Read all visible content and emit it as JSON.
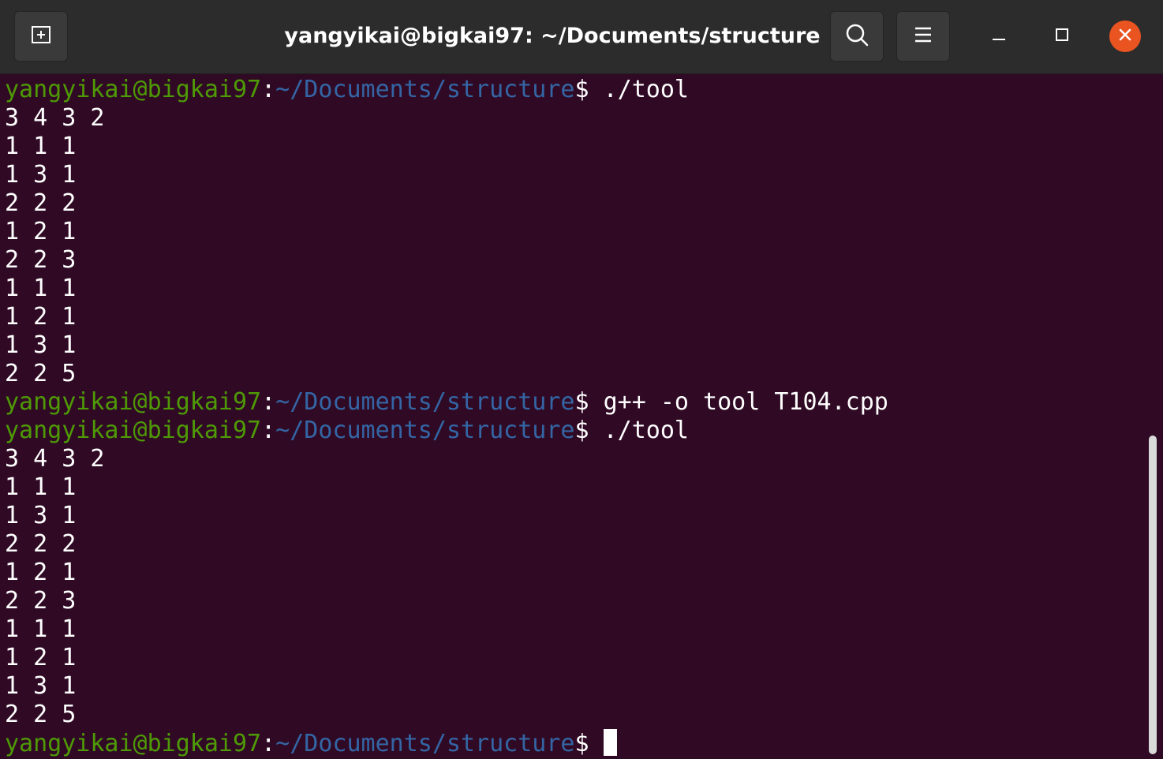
{
  "window": {
    "title": "yangyikai@bigkai97: ~/Documents/structure",
    "accent_close": "#e95420",
    "background": "#300a24"
  },
  "headerbar": {
    "new_tab_icon": "new-tab-icon",
    "search_icon": "search-icon",
    "menu_icon": "hamburger-menu-icon",
    "minimize_icon": "minimize-icon",
    "maximize_icon": "maximize-icon",
    "close_icon": "close-icon"
  },
  "prompt": {
    "user": "yangyikai@bigkai97",
    "colon": ":",
    "path": "~/Documents/structure",
    "dollar": "$",
    "user_color": "#4e9a06",
    "path_color": "#3465a4"
  },
  "terminal": {
    "lines": [
      {
        "type": "prompt",
        "command": " ./tool"
      },
      {
        "type": "output",
        "text": "3 4 3 2"
      },
      {
        "type": "output",
        "text": "1 1 1"
      },
      {
        "type": "output",
        "text": "1 3 1"
      },
      {
        "type": "output",
        "text": "2 2 2"
      },
      {
        "type": "output",
        "text": "1 2 1"
      },
      {
        "type": "output",
        "text": "2 2 3"
      },
      {
        "type": "output",
        "text": "1 1 1"
      },
      {
        "type": "output",
        "text": "1 2 1"
      },
      {
        "type": "output",
        "text": "1 3 1"
      },
      {
        "type": "output",
        "text": "2 2 5"
      },
      {
        "type": "prompt",
        "command": " g++ -o tool T104.cpp"
      },
      {
        "type": "prompt",
        "command": " ./tool"
      },
      {
        "type": "output",
        "text": "3 4 3 2"
      },
      {
        "type": "output",
        "text": "1 1 1"
      },
      {
        "type": "output",
        "text": "1 3 1"
      },
      {
        "type": "output",
        "text": "2 2 2"
      },
      {
        "type": "output",
        "text": "1 2 1"
      },
      {
        "type": "output",
        "text": "2 2 3"
      },
      {
        "type": "output",
        "text": "1 1 1"
      },
      {
        "type": "output",
        "text": "1 2 1"
      },
      {
        "type": "output",
        "text": "1 3 1"
      },
      {
        "type": "output",
        "text": "2 2 5"
      },
      {
        "type": "prompt",
        "command": " ",
        "cursor": true
      }
    ]
  }
}
